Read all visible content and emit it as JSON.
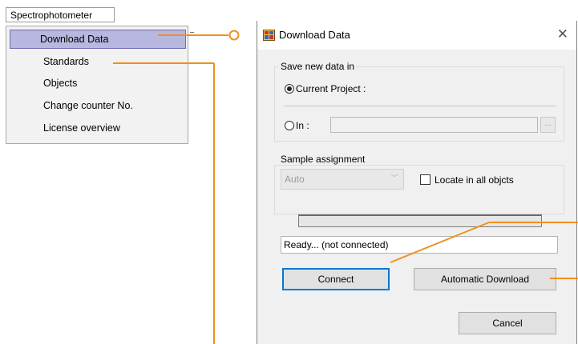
{
  "menu": {
    "bar_label": "Spectrophotometer",
    "items": [
      {
        "label": "Download Data",
        "highlighted": true
      },
      {
        "label": "Standards"
      },
      {
        "label": "Objects"
      },
      {
        "label": "Change counter No."
      },
      {
        "label": "License overview"
      }
    ]
  },
  "dialog": {
    "title": "Download Data",
    "save_group": {
      "label": "Save new data in",
      "current_project_label": "Current Project :",
      "in_label": "In :",
      "browse_label": "...",
      "selected": "current_project"
    },
    "sample_group": {
      "label": "Sample assignment",
      "select_value": "Auto",
      "locate_label": "Locate in all objcts",
      "locate_checked": false
    },
    "status_text": "Ready... (not connected)",
    "connect_label": "Connect",
    "auto_download_label": "Automatic Download",
    "cancel_label": "Cancel"
  },
  "colors": {
    "callout": "#f0901e",
    "highlight_fill": "#b8b7df",
    "highlight_border": "#6f6cb5",
    "default_button_border": "#0078d7"
  }
}
